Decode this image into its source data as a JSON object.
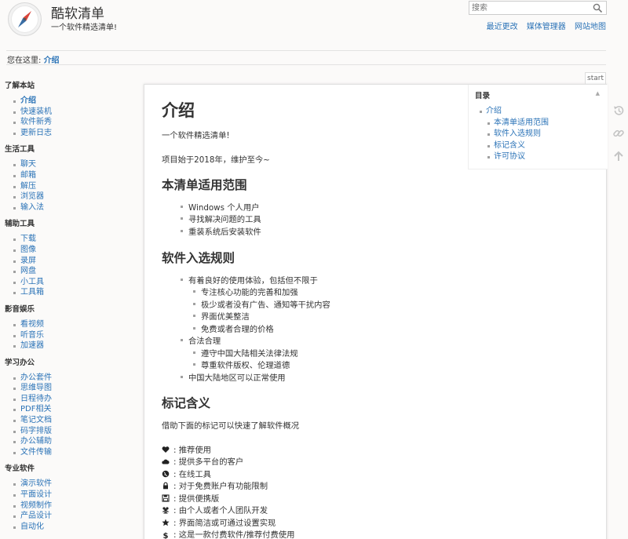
{
  "header": {
    "title": "酷软清单",
    "tagline": "一个软件精选清单!",
    "search_placeholder": "搜索",
    "usertools": [
      "最近更改",
      "媒体管理器",
      "网站地图"
    ]
  },
  "breadcrumb": {
    "label": "您在这里:",
    "current": "介绍"
  },
  "sidebar": {
    "sections": [
      {
        "title": "了解本站",
        "items": [
          "介绍",
          "快速装机",
          "软件新秀",
          "更新日志"
        ]
      },
      {
        "title": "生活工具",
        "items": [
          "聊天",
          "邮箱",
          "解压",
          "浏览器",
          "输入法"
        ]
      },
      {
        "title": "辅助工具",
        "items": [
          "下载",
          "图像",
          "录屏",
          "网盘",
          "小工具",
          "工具箱"
        ]
      },
      {
        "title": "影音娱乐",
        "items": [
          "看视频",
          "听音乐",
          "加速器"
        ]
      },
      {
        "title": "学习办公",
        "items": [
          "办公套件",
          "思维导图",
          "日程待办",
          "PDF相关",
          "笔记文档",
          "码字排版",
          "办公辅助",
          "文件传输"
        ]
      },
      {
        "title": "专业软件",
        "items": [
          "演示软件",
          "平面设计",
          "视频制作",
          "产品设计",
          "自动化"
        ]
      }
    ]
  },
  "page_tab": "start",
  "toc": {
    "title": "目录",
    "items": [
      "介绍",
      "本清单适用范围",
      "软件入选规则",
      "标记含义",
      "许可协议"
    ]
  },
  "content": {
    "title": "介绍",
    "intro": "一个软件精选清单!",
    "since": "项目始于2018年，维护至今~",
    "scope_heading": "本清单适用范围",
    "scope_items": [
      "Windows 个人用户",
      "寻找解决问题的工具",
      "重装系统后安装软件"
    ],
    "rules_heading": "软件入选规则",
    "rules": {
      "r1": "有着良好的使用体验，包括但不限于",
      "r1_sub": [
        "专注核心功能的完善和加强",
        "极少或者没有广告、通知等干扰内容",
        "界面优美整洁",
        "免费或者合理的价格"
      ],
      "r2": "合法合理",
      "r2_sub": [
        "遵守中国大陆相关法律法规",
        "尊重软件版权、伦理道德"
      ],
      "r3": "中国大陆地区可以正常使用"
    },
    "marks_heading": "标记含义",
    "marks_intro": "借助下面的标记可以快速了解软件概况",
    "marks": [
      {
        "icon": "heart-icon",
        "text": ": 推荐使用"
      },
      {
        "icon": "cloud-icon",
        "text": ": 提供多平台的客户"
      },
      {
        "icon": "globe-icon",
        "text": ": 在线工具"
      },
      {
        "icon": "lock-icon",
        "text": ": 对于免费账户有功能限制"
      },
      {
        "icon": "save-icon",
        "text": ": 提供便携版"
      },
      {
        "icon": "users-icon",
        "text": ": 由个人或者个人团队开发"
      },
      {
        "icon": "star-icon",
        "text": ": 界面简洁或可通过设置实现"
      },
      {
        "icon": "dollar-icon",
        "text": ": 这是一款付费软件/推荐付费使用"
      }
    ]
  },
  "colors": {
    "link": "#2b73b7",
    "text": "#333333",
    "background": "#fbfaf9"
  }
}
